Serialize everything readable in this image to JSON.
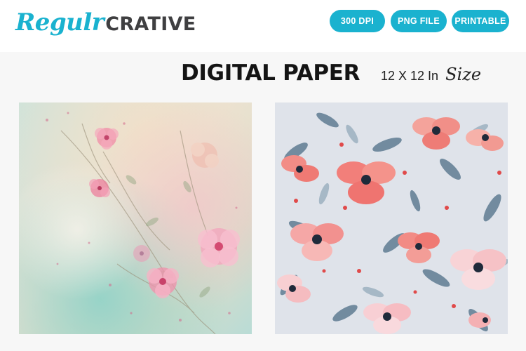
{
  "brand": {
    "script_part": "Regulr",
    "bold_part": "CRATIVE"
  },
  "badges": [
    "300 DPI",
    "PNG FILE",
    "PRINTABLE"
  ],
  "title": "DIGITAL PAPER",
  "size": {
    "dimensions": "12 X 12 In",
    "word": "Size"
  },
  "colors": {
    "accent": "#1ab2cf",
    "logo_dark": "#3f3f41",
    "title": "#141414"
  },
  "papers": [
    {
      "style": "watercolor-floral-pastel"
    },
    {
      "style": "coral-pink-floral-blue-leaves"
    }
  ]
}
